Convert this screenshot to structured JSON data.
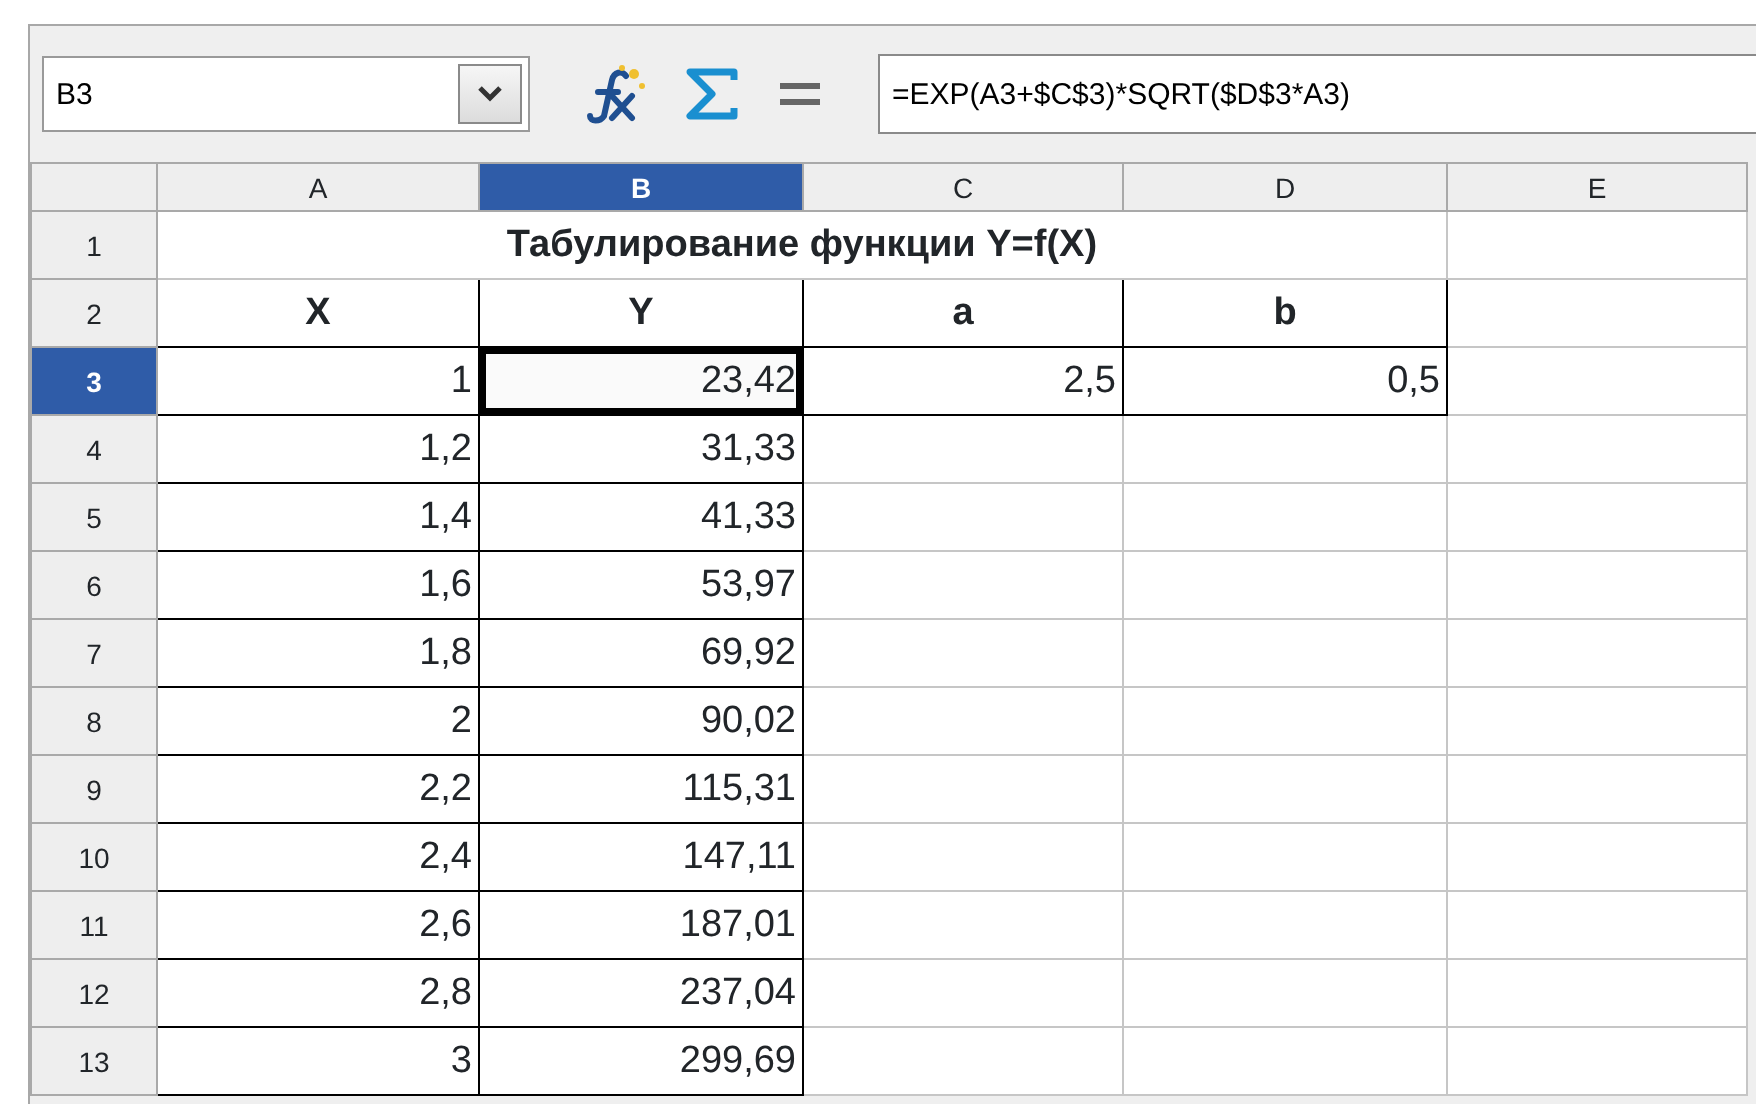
{
  "name_box": {
    "value": "B3"
  },
  "formula": {
    "value": "=EXP(A3+$C$3)*SQRT($D$3*A3)"
  },
  "columns": [
    {
      "label": "A",
      "selected": false
    },
    {
      "label": "B",
      "selected": true
    },
    {
      "label": "C",
      "selected": false
    },
    {
      "label": "D",
      "selected": false
    },
    {
      "label": "E",
      "selected": false
    }
  ],
  "rows": [
    {
      "number": "1",
      "selected": false,
      "kind": "title",
      "title": "Табулирование функции Y=f(X)"
    },
    {
      "number": "2",
      "selected": false,
      "kind": "cells",
      "cells": [
        {
          "kind": "label",
          "text": "X",
          "bordered": true,
          "active": false
        },
        {
          "kind": "label",
          "text": "Y",
          "bordered": true,
          "active": false
        },
        {
          "kind": "label",
          "text": "a",
          "bordered": true,
          "active": false
        },
        {
          "kind": "label",
          "text": "b",
          "bordered": true,
          "active": false
        },
        {
          "kind": "blank",
          "bordered": false,
          "active": false
        }
      ]
    },
    {
      "number": "3",
      "selected": true,
      "kind": "cells",
      "cells": [
        {
          "kind": "number",
          "text": "1",
          "bordered": true,
          "active": false
        },
        {
          "kind": "number",
          "text": "23,42",
          "bordered": true,
          "active": true
        },
        {
          "kind": "number",
          "text": "2,5",
          "bordered": true,
          "active": false
        },
        {
          "kind": "number",
          "text": "0,5",
          "bordered": true,
          "active": false
        },
        {
          "kind": "blank",
          "bordered": false,
          "active": false
        }
      ]
    },
    {
      "number": "4",
      "selected": false,
      "kind": "cells",
      "cells": [
        {
          "kind": "number",
          "text": "1,2",
          "bordered": true,
          "active": false
        },
        {
          "kind": "number",
          "text": "31,33",
          "bordered": true,
          "active": false
        },
        {
          "kind": "blank",
          "bordered": false,
          "active": false
        },
        {
          "kind": "blank",
          "bordered": false,
          "active": false
        },
        {
          "kind": "blank",
          "bordered": false,
          "active": false
        }
      ]
    },
    {
      "number": "5",
      "selected": false,
      "kind": "cells",
      "cells": [
        {
          "kind": "number",
          "text": "1,4",
          "bordered": true,
          "active": false
        },
        {
          "kind": "number",
          "text": "41,33",
          "bordered": true,
          "active": false
        },
        {
          "kind": "blank",
          "bordered": false,
          "active": false
        },
        {
          "kind": "blank",
          "bordered": false,
          "active": false
        },
        {
          "kind": "blank",
          "bordered": false,
          "active": false
        }
      ]
    },
    {
      "number": "6",
      "selected": false,
      "kind": "cells",
      "cells": [
        {
          "kind": "number",
          "text": "1,6",
          "bordered": true,
          "active": false
        },
        {
          "kind": "number",
          "text": "53,97",
          "bordered": true,
          "active": false
        },
        {
          "kind": "blank",
          "bordered": false,
          "active": false
        },
        {
          "kind": "blank",
          "bordered": false,
          "active": false
        },
        {
          "kind": "blank",
          "bordered": false,
          "active": false
        }
      ]
    },
    {
      "number": "7",
      "selected": false,
      "kind": "cells",
      "cells": [
        {
          "kind": "number",
          "text": "1,8",
          "bordered": true,
          "active": false
        },
        {
          "kind": "number",
          "text": "69,92",
          "bordered": true,
          "active": false
        },
        {
          "kind": "blank",
          "bordered": false,
          "active": false
        },
        {
          "kind": "blank",
          "bordered": false,
          "active": false
        },
        {
          "kind": "blank",
          "bordered": false,
          "active": false
        }
      ]
    },
    {
      "number": "8",
      "selected": false,
      "kind": "cells",
      "cells": [
        {
          "kind": "number",
          "text": "2",
          "bordered": true,
          "active": false
        },
        {
          "kind": "number",
          "text": "90,02",
          "bordered": true,
          "active": false
        },
        {
          "kind": "blank",
          "bordered": false,
          "active": false
        },
        {
          "kind": "blank",
          "bordered": false,
          "active": false
        },
        {
          "kind": "blank",
          "bordered": false,
          "active": false
        }
      ]
    },
    {
      "number": "9",
      "selected": false,
      "kind": "cells",
      "cells": [
        {
          "kind": "number",
          "text": "2,2",
          "bordered": true,
          "active": false
        },
        {
          "kind": "number",
          "text": "115,31",
          "bordered": true,
          "active": false
        },
        {
          "kind": "blank",
          "bordered": false,
          "active": false
        },
        {
          "kind": "blank",
          "bordered": false,
          "active": false
        },
        {
          "kind": "blank",
          "bordered": false,
          "active": false
        }
      ]
    },
    {
      "number": "10",
      "selected": false,
      "kind": "cells",
      "cells": [
        {
          "kind": "number",
          "text": "2,4",
          "bordered": true,
          "active": false
        },
        {
          "kind": "number",
          "text": "147,11",
          "bordered": true,
          "active": false
        },
        {
          "kind": "blank",
          "bordered": false,
          "active": false
        },
        {
          "kind": "blank",
          "bordered": false,
          "active": false
        },
        {
          "kind": "blank",
          "bordered": false,
          "active": false
        }
      ]
    },
    {
      "number": "11",
      "selected": false,
      "kind": "cells",
      "cells": [
        {
          "kind": "number",
          "text": "2,6",
          "bordered": true,
          "active": false
        },
        {
          "kind": "number",
          "text": "187,01",
          "bordered": true,
          "active": false
        },
        {
          "kind": "blank",
          "bordered": false,
          "active": false
        },
        {
          "kind": "blank",
          "bordered": false,
          "active": false
        },
        {
          "kind": "blank",
          "bordered": false,
          "active": false
        }
      ]
    },
    {
      "number": "12",
      "selected": false,
      "kind": "cells",
      "cells": [
        {
          "kind": "number",
          "text": "2,8",
          "bordered": true,
          "active": false
        },
        {
          "kind": "number",
          "text": "237,04",
          "bordered": true,
          "active": false
        },
        {
          "kind": "blank",
          "bordered": false,
          "active": false
        },
        {
          "kind": "blank",
          "bordered": false,
          "active": false
        },
        {
          "kind": "blank",
          "bordered": false,
          "active": false
        }
      ]
    },
    {
      "number": "13",
      "selected": false,
      "kind": "cells",
      "cells": [
        {
          "kind": "number",
          "text": "3",
          "bordered": true,
          "active": false
        },
        {
          "kind": "number",
          "text": "299,69",
          "bordered": true,
          "active": false
        },
        {
          "kind": "blank",
          "bordered": false,
          "active": false
        },
        {
          "kind": "blank",
          "bordered": false,
          "active": false
        },
        {
          "kind": "blank",
          "bordered": false,
          "active": false
        }
      ]
    }
  ]
}
